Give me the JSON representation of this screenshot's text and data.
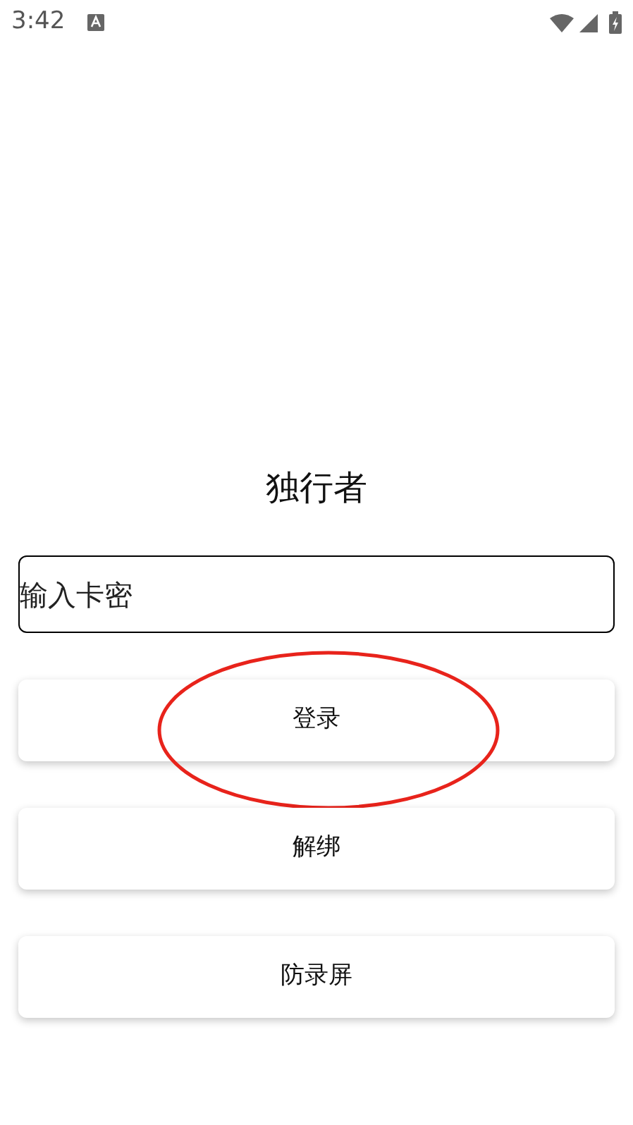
{
  "status_bar": {
    "time": "3:42"
  },
  "title": "独行者",
  "card_field": {
    "placeholder": "输入卡密"
  },
  "buttons": [
    {
      "label": "登录",
      "circled": true
    },
    {
      "label": "解绑",
      "circled": false
    },
    {
      "label": "防录屏",
      "circled": false
    }
  ]
}
